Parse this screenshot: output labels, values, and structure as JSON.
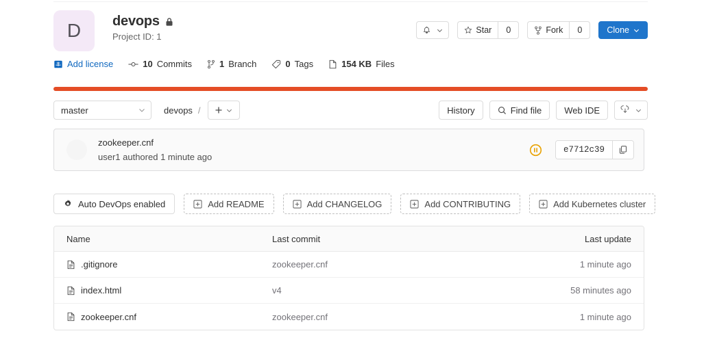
{
  "project": {
    "avatar_letter": "D",
    "name": "devops",
    "visibility_icon": "lock-icon",
    "project_id_label": "Project ID: 1"
  },
  "header_actions": {
    "notification_icon": "bell-icon",
    "notification_caret": "chevron-down-icon",
    "star_label": "Star",
    "star_count": "0",
    "star_icon": "star-icon",
    "fork_label": "Fork",
    "fork_count": "0",
    "fork_icon": "fork-icon",
    "clone_label": "Clone",
    "clone_caret": "chevron-down-icon",
    "clone_color": "#1f75cb"
  },
  "stats": [
    {
      "icon": "license-icon",
      "num": "",
      "label": "Add license",
      "link": true
    },
    {
      "icon": "commit-icon",
      "num": "10",
      "label": "Commits",
      "link": false
    },
    {
      "icon": "branch-icon",
      "num": "1",
      "label": "Branch",
      "link": false
    },
    {
      "icon": "tag-icon",
      "num": "0",
      "label": "Tags",
      "link": false
    },
    {
      "icon": "file-size-icon",
      "num": "154 KB",
      "label": "Files",
      "link": false
    }
  ],
  "language_bar": {
    "color": "#e44d26"
  },
  "toolbar": {
    "branch": "master",
    "branch_caret": "chevron-down-icon",
    "breadcrumb_root": "devops",
    "breadcrumb_separator": "/",
    "add_icon": "plus-icon",
    "add_caret": "chevron-down-icon",
    "history_label": "History",
    "find_file_label": "Find file",
    "find_file_icon": "search-icon",
    "web_ide_label": "Web IDE",
    "download_icon": "download-icon",
    "download_caret": "chevron-down-icon"
  },
  "last_commit": {
    "message": "zookeeper.cnf",
    "author_line": "user1 authored 1 minute ago",
    "pipeline_status_icon": "pipeline-paused-icon",
    "pipeline_status_color": "#e9a100",
    "sha": "e7712c39",
    "copy_icon": "copy-icon"
  },
  "quick_actions": [
    {
      "label": "Auto DevOps enabled",
      "icon": "gear-icon",
      "style": "solid"
    },
    {
      "label": "Add README",
      "icon": "plus-square-icon",
      "style": "dashed"
    },
    {
      "label": "Add CHANGELOG",
      "icon": "plus-square-icon",
      "style": "dashed"
    },
    {
      "label": "Add CONTRIBUTING",
      "icon": "plus-square-icon",
      "style": "dashed"
    },
    {
      "label": "Add Kubernetes cluster",
      "icon": "plus-square-icon",
      "style": "dashed"
    }
  ],
  "file_table": {
    "columns": {
      "name": "Name",
      "last_commit": "Last commit",
      "last_update": "Last update"
    },
    "rows": [
      {
        "icon": "file-icon",
        "name": ".gitignore",
        "last_commit": "zookeeper.cnf",
        "last_update": "1 minute ago"
      },
      {
        "icon": "file-icon",
        "name": "index.html",
        "last_commit": "v4",
        "last_update": "58 minutes ago"
      },
      {
        "icon": "file-icon",
        "name": "zookeeper.cnf",
        "last_commit": "zookeeper.cnf",
        "last_update": "1 minute ago"
      }
    ]
  }
}
